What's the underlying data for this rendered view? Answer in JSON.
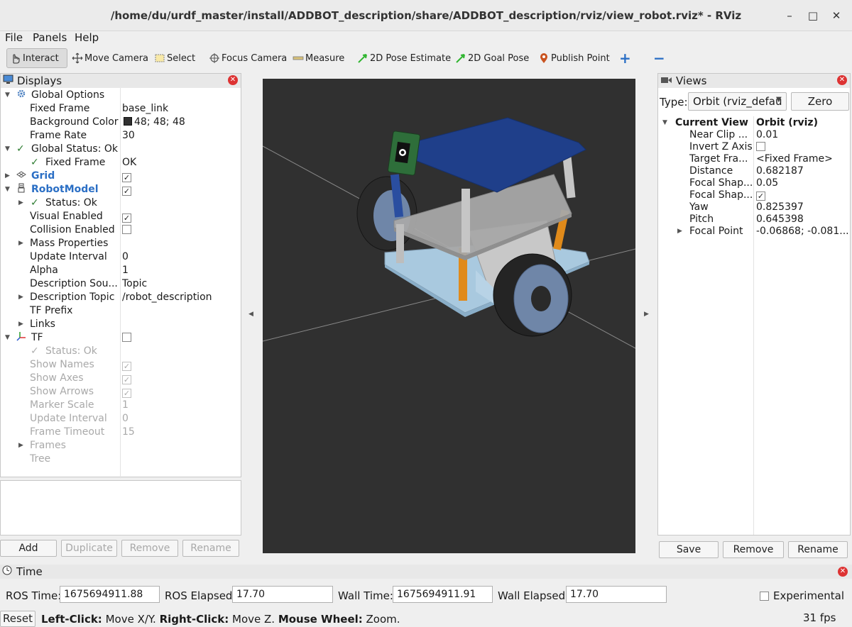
{
  "window": {
    "title": "/home/du/urdf_master/install/ADDBOT_description/share/ADDBOT_description/rviz/view_robot.rviz* - RViz"
  },
  "menu": {
    "file": "File",
    "panels": "Panels",
    "help": "Help"
  },
  "toolbar": {
    "interact": "Interact",
    "move_camera": "Move Camera",
    "select": "Select",
    "focus_camera": "Focus Camera",
    "measure": "Measure",
    "pose_estimate": "2D Pose Estimate",
    "goal_pose": "2D Goal Pose",
    "publish_point": "Publish Point",
    "add_tool": "+",
    "remove_tool": "−"
  },
  "displays": {
    "title": "Displays",
    "rows": {
      "global_options": "Global Options",
      "fixed_frame": "Fixed Frame",
      "fixed_frame_val": "base_link",
      "bg_color": "Background Color",
      "bg_color_val": "48; 48; 48",
      "frame_rate": "Frame Rate",
      "frame_rate_val": "30",
      "global_status": "Global Status: Ok",
      "gs_fixed_frame": "Fixed Frame",
      "gs_fixed_frame_val": "OK",
      "grid": "Grid",
      "robot_model": "RobotModel",
      "rm_status": "Status: Ok",
      "visual_enabled": "Visual Enabled",
      "collision_enabled": "Collision Enabled",
      "mass_properties": "Mass Properties",
      "update_interval": "Update Interval",
      "update_interval_val": "0",
      "alpha": "Alpha",
      "alpha_val": "1",
      "desc_source": "Description Sou...",
      "desc_source_val": "Topic",
      "desc_topic": "Description Topic",
      "desc_topic_val": "/robot_description",
      "tf_prefix": "TF Prefix",
      "links": "Links",
      "tf": "TF",
      "tf_status": "Status: Ok",
      "show_names": "Show Names",
      "show_axes": "Show Axes",
      "show_arrows": "Show Arrows",
      "marker_scale": "Marker Scale",
      "marker_scale_val": "1",
      "tf_update_interval": "Update Interval",
      "tf_update_interval_val": "0",
      "frame_timeout": "Frame Timeout",
      "frame_timeout_val": "15",
      "frames": "Frames",
      "tree": "Tree"
    },
    "buttons": {
      "add": "Add",
      "duplicate": "Duplicate",
      "remove": "Remove",
      "rename": "Rename"
    }
  },
  "views": {
    "title": "Views",
    "type_label": "Type:",
    "type_value": "Orbit (rviz_defau",
    "zero": "Zero",
    "rows": {
      "current_view": "Current View",
      "current_view_val": "Orbit (rviz)",
      "near_clip": "Near Clip ...",
      "near_clip_val": "0.01",
      "invert_z": "Invert Z Axis",
      "target_frame": "Target Fra...",
      "target_frame_val": "<Fixed Frame>",
      "distance": "Distance",
      "distance_val": "0.682187",
      "focal_shape1": "Focal Shap...",
      "focal_shape1_val": "0.05",
      "focal_shape2": "Focal Shap...",
      "yaw": "Yaw",
      "yaw_val": "0.825397",
      "pitch": "Pitch",
      "pitch_val": "0.645398",
      "focal_point": "Focal Point",
      "focal_point_val": "-0.06868; -0.081..."
    },
    "buttons": {
      "save": "Save",
      "remove": "Remove",
      "rename": "Rename"
    }
  },
  "time": {
    "title": "Time",
    "ros_time_label": "ROS Time:",
    "ros_time": "1675694911.88",
    "ros_elapsed_label": "ROS Elapsed:",
    "ros_elapsed": "17.70",
    "wall_time_label": "Wall Time:",
    "wall_time": "1675694911.91",
    "wall_elapsed_label": "Wall Elapsed:",
    "wall_elapsed": "17.70",
    "experimental": "Experimental"
  },
  "status": {
    "reset": "Reset",
    "left_click": "Left-Click:",
    "left_click_desc": " Move X/Y. ",
    "right_click": "Right-Click:",
    "right_click_desc": " Move Z. ",
    "wheel": "Mouse Wheel:",
    "wheel_desc": " Zoom.",
    "fps": "31 fps"
  },
  "colors": {
    "viewport_bg": "#303030",
    "top_plate": "#1f3f8a",
    "mid_plate": "#a8a8a8",
    "base_plate": "#a9c9df",
    "wheel": "#2a2a2a",
    "hub": "#6f86a8",
    "pillar_orange": "#e08a1a",
    "pillar_blue": "#2a4ea0"
  },
  "icons": {
    "displays": "monitor-icon",
    "views": "camera-icon",
    "time": "clock-icon",
    "global_options": "gear-icon",
    "grid": "grid-icon",
    "robot_model": "robot-icon",
    "tf": "axes-icon"
  }
}
